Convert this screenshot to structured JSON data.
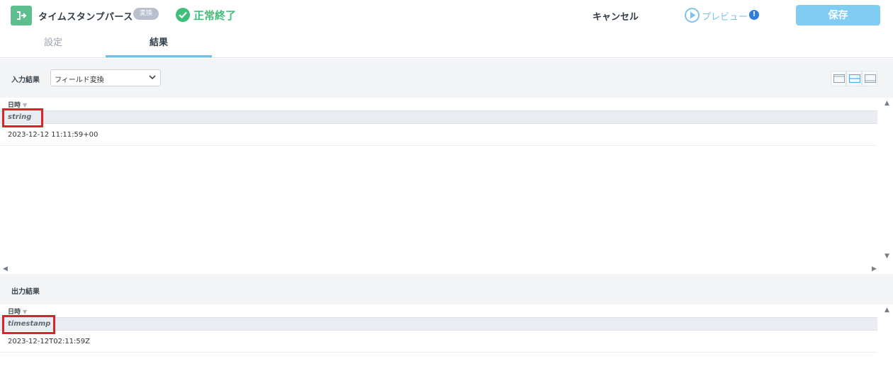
{
  "header": {
    "title": "タイムスタンプパース",
    "badge": "変換",
    "status": "正常終了",
    "cancel_label": "キャンセル",
    "preview_label": "プレビュー",
    "warning_mark": "!",
    "save_label": "保存"
  },
  "tabs": [
    {
      "label": "設定",
      "active": false
    },
    {
      "label": "結果",
      "active": true
    }
  ],
  "input_section": {
    "label": "入力結果",
    "select_value": "フィールド変換",
    "column": {
      "name": "日時",
      "sort_mark": "▼",
      "type": "string"
    },
    "rows": [
      "2023-12-12 11:11:59+00"
    ]
  },
  "output_section": {
    "label": "出力結果",
    "column": {
      "name": "日時",
      "sort_mark": "▼",
      "type": "timestamp"
    },
    "rows": [
      "2023-12-12T02:11:59Z"
    ]
  },
  "colors": {
    "accent": "#7fcdf3",
    "success": "#3ec07b",
    "highlight_box": "#e0202a",
    "app_icon": "#5dbf8e"
  },
  "icons": [
    "transform-icon",
    "check-circle-icon",
    "play-circle-icon",
    "info-icon",
    "chevron-down-icon",
    "layout-top-icon",
    "layout-split-icon",
    "layout-bottom-icon"
  ]
}
